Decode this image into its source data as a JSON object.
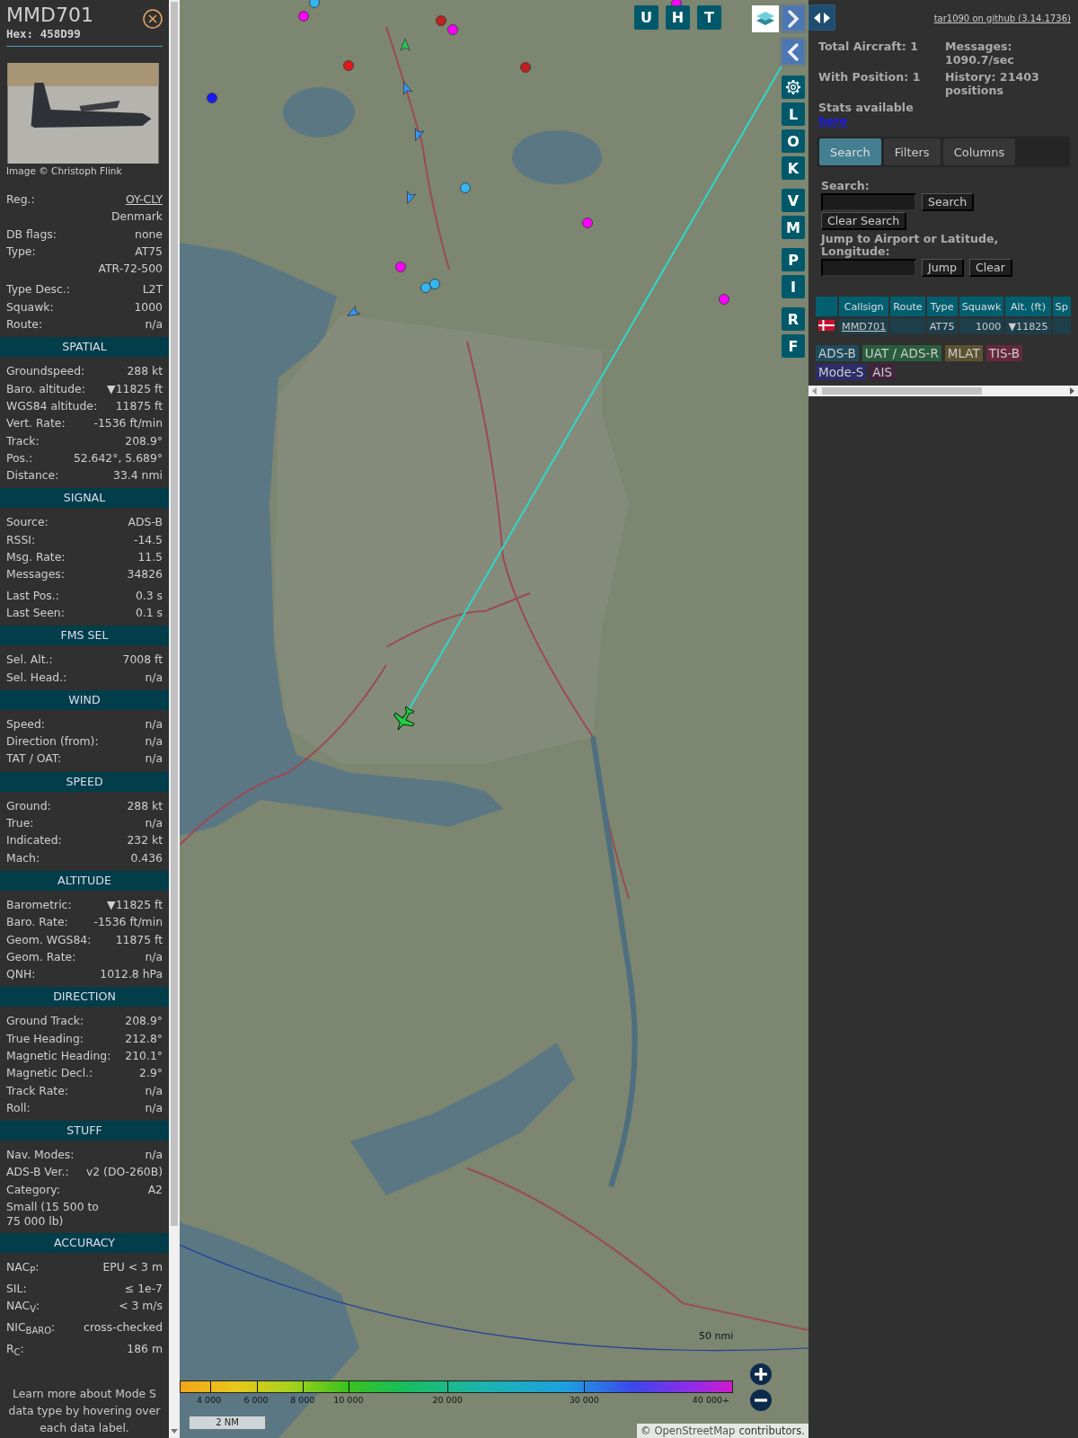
{
  "info": {
    "callsign": "MMD701",
    "hex": "Hex: 458D99",
    "photo_credit": "Image © Christoph Flink",
    "top_groups": [
      [
        {
          "kind": "link",
          "label": "Reg.:",
          "value": "OY-CLY"
        },
        {
          "kind": "value",
          "value": "Denmark"
        },
        {
          "kind": "pair",
          "label": "DB flags:",
          "value": "none"
        },
        {
          "kind": "pair",
          "label": "Type:",
          "value": "AT75"
        },
        {
          "kind": "value",
          "value": "ATR-72-500"
        }
      ],
      [
        {
          "kind": "pair",
          "label": "Type Desc.:",
          "value": "L2T"
        },
        {
          "kind": "pair",
          "label": "Squawk:",
          "value": "1000"
        },
        {
          "kind": "pair",
          "label": "Route:",
          "value": "n/a"
        }
      ]
    ],
    "sections": [
      {
        "title": "SPATIAL",
        "groups": [
          [
            {
              "kind": "pair",
              "label": "Groundspeed:",
              "value": "288 kt"
            },
            {
              "kind": "pair",
              "label": "Baro. altitude:",
              "value": "▼11825 ft"
            },
            {
              "kind": "pair",
              "label": "WGS84 altitude:",
              "value": "11875 ft"
            },
            {
              "kind": "pair",
              "label": "Vert. Rate:",
              "value": "-1536 ft/min"
            },
            {
              "kind": "pair",
              "label": "Track:",
              "value": "208.9°"
            },
            {
              "kind": "pair",
              "label": "Pos.:",
              "value": "52.642°, 5.689°"
            },
            {
              "kind": "pair",
              "label": "Distance:",
              "value": "33.4 nmi"
            }
          ]
        ]
      },
      {
        "title": "SIGNAL",
        "groups": [
          [
            {
              "kind": "pair",
              "label": "Source:",
              "value": "ADS-B"
            },
            {
              "kind": "pair",
              "label": "RSSI:",
              "value": "-14.5"
            },
            {
              "kind": "pair",
              "label": "Msg. Rate:",
              "value": "11.5"
            },
            {
              "kind": "pair",
              "label": "Messages:",
              "value": "34826"
            }
          ],
          [
            {
              "kind": "pair",
              "label": "Last Pos.:",
              "value": "0.3 s"
            },
            {
              "kind": "pair",
              "label": "Last Seen:",
              "value": "0.1 s"
            }
          ]
        ]
      },
      {
        "title": "FMS SEL",
        "groups": [
          [
            {
              "kind": "pair",
              "label": "Sel. Alt.:",
              "value": "7008 ft"
            },
            {
              "kind": "pair",
              "label": "Sel. Head.:",
              "value": "n/a"
            }
          ]
        ]
      },
      {
        "title": "WIND",
        "groups": [
          [
            {
              "kind": "pair",
              "label": "Speed:",
              "value": "n/a"
            },
            {
              "kind": "pair",
              "label": "Direction (from):",
              "value": "n/a"
            },
            {
              "kind": "pair",
              "label": "TAT / OAT:",
              "value": "n/a"
            }
          ]
        ]
      },
      {
        "title": "SPEED",
        "groups": [
          [
            {
              "kind": "pair",
              "label": "Ground:",
              "value": "288 kt"
            },
            {
              "kind": "pair",
              "label": "True:",
              "value": "n/a"
            },
            {
              "kind": "pair",
              "label": "Indicated:",
              "value": "232 kt"
            },
            {
              "kind": "pair",
              "label": "Mach:",
              "value": "0.436"
            }
          ]
        ]
      },
      {
        "title": "ALTITUDE",
        "groups": [
          [
            {
              "kind": "pair",
              "label": "Barometric:",
              "value": "▼11825 ft"
            },
            {
              "kind": "pair",
              "label": "Baro. Rate:",
              "value": "-1536 ft/min"
            },
            {
              "kind": "pair",
              "label": "Geom. WGS84:",
              "value": "11875 ft"
            },
            {
              "kind": "pair",
              "label": "Geom. Rate:",
              "value": "n/a"
            },
            {
              "kind": "pair",
              "label": "QNH:",
              "value": "1012.8 hPa"
            }
          ]
        ]
      },
      {
        "title": "DIRECTION",
        "groups": [
          [
            {
              "kind": "pair",
              "label": "Ground Track:",
              "value": "208.9°"
            },
            {
              "kind": "pair",
              "label": "True Heading:",
              "value": "212.8°"
            },
            {
              "kind": "pair",
              "label": "Magnetic Heading:",
              "value": "210.1°"
            },
            {
              "kind": "pair",
              "label": "Magnetic Decl.:",
              "value": "2.9°"
            },
            {
              "kind": "pair",
              "label": "Track Rate:",
              "value": "n/a"
            },
            {
              "kind": "pair",
              "label": "Roll:",
              "value": "n/a"
            }
          ]
        ]
      },
      {
        "title": "STUFF",
        "groups": [
          [
            {
              "kind": "pair",
              "label": "Nav. Modes:",
              "value": "n/a"
            },
            {
              "kind": "pair",
              "label": "ADS-B Ver.:",
              "value": "v2 (DO-260B)"
            },
            {
              "kind": "pair",
              "label": "Category:",
              "value": "A2"
            },
            {
              "kind": "note",
              "value": "Small (15 500 to 75 000 lb)"
            }
          ]
        ]
      },
      {
        "title": "ACCURACY",
        "groups": [
          [
            {
              "kind": "pair",
              "label": "NAC$_{P}$:",
              "value": "EPU < 3 m"
            },
            {
              "kind": "pair",
              "label": "SIL:",
              "value": "≤ 1e-7"
            },
            {
              "kind": "pair",
              "label": "NAC$_{V}$:",
              "value": "< 3 m/s"
            },
            {
              "kind": "pair",
              "label": "NIC$_{BARO}$:",
              "value": "cross-checked"
            },
            {
              "kind": "pair",
              "label": "R$_{C}$:",
              "value": "186 m"
            }
          ]
        ]
      }
    ],
    "footer": "Learn more about Mode S data type by hovering over each data label."
  },
  "map": {
    "top_buttons": [
      "U",
      "H",
      "T"
    ],
    "side_groups": [
      [
        {
          "kind": "next"
        },
        {
          "kind": "prev"
        }
      ],
      [
        {
          "kind": "settings"
        },
        {
          "kind": "letter",
          "label": "L"
        },
        {
          "kind": "letter",
          "label": "O"
        },
        {
          "kind": "letter",
          "label": "K"
        }
      ],
      [
        {
          "kind": "letter",
          "label": "V"
        },
        {
          "kind": "letter",
          "label": "M"
        }
      ],
      [
        {
          "kind": "letter",
          "label": "P"
        },
        {
          "kind": "letter",
          "label": "I"
        }
      ],
      [
        {
          "kind": "letter",
          "label": "R"
        },
        {
          "kind": "letter",
          "label": "F"
        }
      ]
    ],
    "range_label": "50 nmi",
    "legend_ticks": [
      "4 000",
      "6 000",
      "8 000",
      "10 000",
      "20 000",
      "30 000",
      "40 000+"
    ],
    "scale": "2 NM",
    "attribution_prefix": "©",
    "attribution_link": "OpenStreetMap",
    "attribution_suffix": "contributors."
  },
  "sidebar": {
    "github_link": "tar1090 on github (3.14.1736)",
    "stats": {
      "total": "Total Aircraft: 1",
      "messages": "Messages: 1090.7/sec",
      "with_position": "With Position: 1",
      "history": "History: 21403 positions",
      "stats_text": "Stats available",
      "stats_link": "here"
    },
    "tabs": [
      {
        "label": "Search",
        "selected": true
      },
      {
        "label": "Filters",
        "selected": false
      },
      {
        "label": "Columns",
        "selected": false
      }
    ],
    "search": {
      "label": "Search:",
      "search_button": "Search",
      "clear_button": "Clear Search",
      "jump_label": "Jump to Airport or Latitude, Longitude:",
      "jump_button": "Jump",
      "jump_clear_button": "Clear"
    },
    "table": {
      "columns": [
        "Callsign",
        "Route",
        "Type",
        "Squawk",
        "Alt. (ft)",
        "Sp"
      ],
      "rows": [
        {
          "callsign": "MMD701",
          "type": "AT75",
          "squawk": "1000",
          "altitude": "▼11825"
        }
      ]
    },
    "legend": [
      {
        "label": "ADS-B",
        "color": "#1f4a5c"
      },
      {
        "label": "UAT / ADS-R",
        "color": "#2a5d3e"
      },
      {
        "label": "MLAT",
        "color": "#5c5230"
      },
      {
        "label": "TIS-B",
        "color": "#66283c"
      },
      {
        "label": "Mode-S",
        "color": "#2d2d6b"
      },
      {
        "label": "AIS",
        "color": "#42233e"
      }
    ]
  }
}
